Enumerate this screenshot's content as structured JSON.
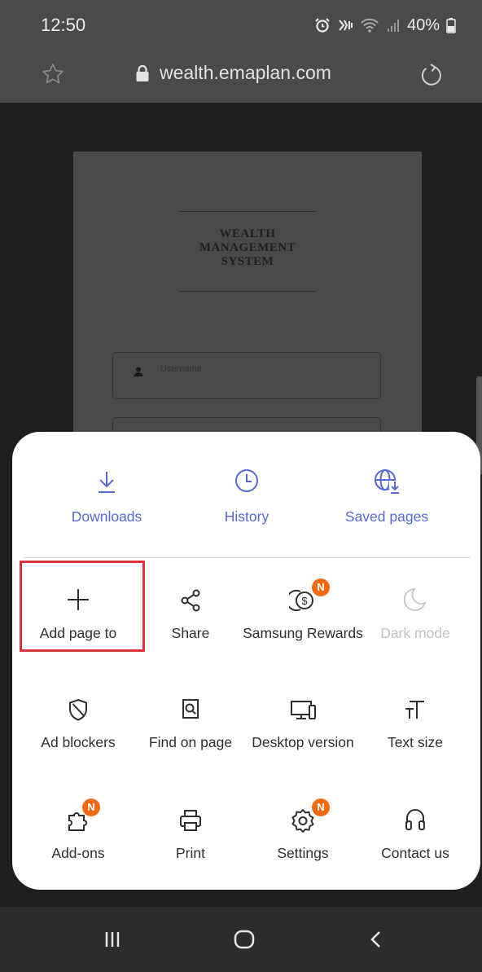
{
  "status_bar": {
    "time": "12:50",
    "battery": "40%",
    "icons": [
      "alarm-icon",
      "vibrate-icon",
      "wifi-icon",
      "signal-icon",
      "battery-icon"
    ]
  },
  "browser": {
    "url": "wealth.emaplan.com",
    "icons": [
      "star-icon",
      "lock-icon",
      "reload-icon"
    ]
  },
  "page": {
    "brand_lines": [
      "WEALTH",
      "MANAGEMENT",
      "SYSTEM"
    ],
    "username_placeholder": "Username"
  },
  "menu": {
    "top_items": [
      {
        "label": "Downloads",
        "icon": "download-icon"
      },
      {
        "label": "History",
        "icon": "clock-icon"
      },
      {
        "label": "Saved pages",
        "icon": "globe-download-icon"
      }
    ],
    "grid_items": [
      {
        "label": "Add page to",
        "icon": "plus-icon",
        "highlighted": true
      },
      {
        "label": "Share",
        "icon": "share-icon"
      },
      {
        "label": "Samsung Rewards",
        "icon": "rewards-icon",
        "badge": "N"
      },
      {
        "label": "Dark mode",
        "icon": "moon-icon",
        "disabled": true
      },
      {
        "label": "Ad blockers",
        "icon": "shield-icon"
      },
      {
        "label": "Find on page",
        "icon": "find-icon"
      },
      {
        "label": "Desktop version",
        "icon": "desktop-icon"
      },
      {
        "label": "Text size",
        "icon": "text-size-icon"
      },
      {
        "label": "Add-ons",
        "icon": "puzzle-icon",
        "badge": "N"
      },
      {
        "label": "Print",
        "icon": "print-icon"
      },
      {
        "label": "Settings",
        "icon": "gear-icon",
        "badge": "N"
      },
      {
        "label": "Contact us",
        "icon": "headset-icon"
      }
    ]
  },
  "nav_bar": {
    "icons": [
      "recents-icon",
      "home-icon",
      "back-icon"
    ]
  },
  "colors": {
    "accent": "#5768d6",
    "badge": "#f16a12",
    "highlight": "#d9343d"
  }
}
